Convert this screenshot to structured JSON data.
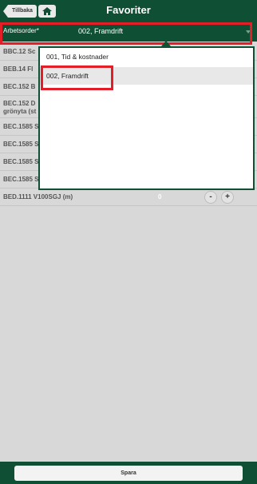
{
  "header": {
    "title": "Favoriter",
    "back_label": "Tillbaka"
  },
  "order": {
    "label": "Arbetsorder*",
    "value": "002, Framdrift"
  },
  "list": {
    "rows": [
      {
        "label": "BBC.12 Sc"
      },
      {
        "label": "BEB.14 Fl"
      },
      {
        "label": "BEC.152 B"
      },
      {
        "label": "BEC.152 D",
        "label2": "grönyta (st"
      },
      {
        "label": "BEC.1585 S"
      },
      {
        "label": "BEC.1585 S"
      },
      {
        "label": "BEC.1585 S"
      },
      {
        "label": "BEC.1585 S"
      },
      {
        "label": "BED.1111 V100SGJ (m)",
        "qty": "0",
        "minus": "-",
        "plus": "+"
      }
    ]
  },
  "dropdown": {
    "options": [
      {
        "label": "001, Tid & kostnader",
        "selected": false
      },
      {
        "label": "002, Framdrift",
        "selected": true
      }
    ]
  },
  "footer": {
    "save_label": "Spara"
  },
  "colors": {
    "header": "#0f4f34",
    "highlight": "#e31e26",
    "background": "#d8d8d8"
  }
}
